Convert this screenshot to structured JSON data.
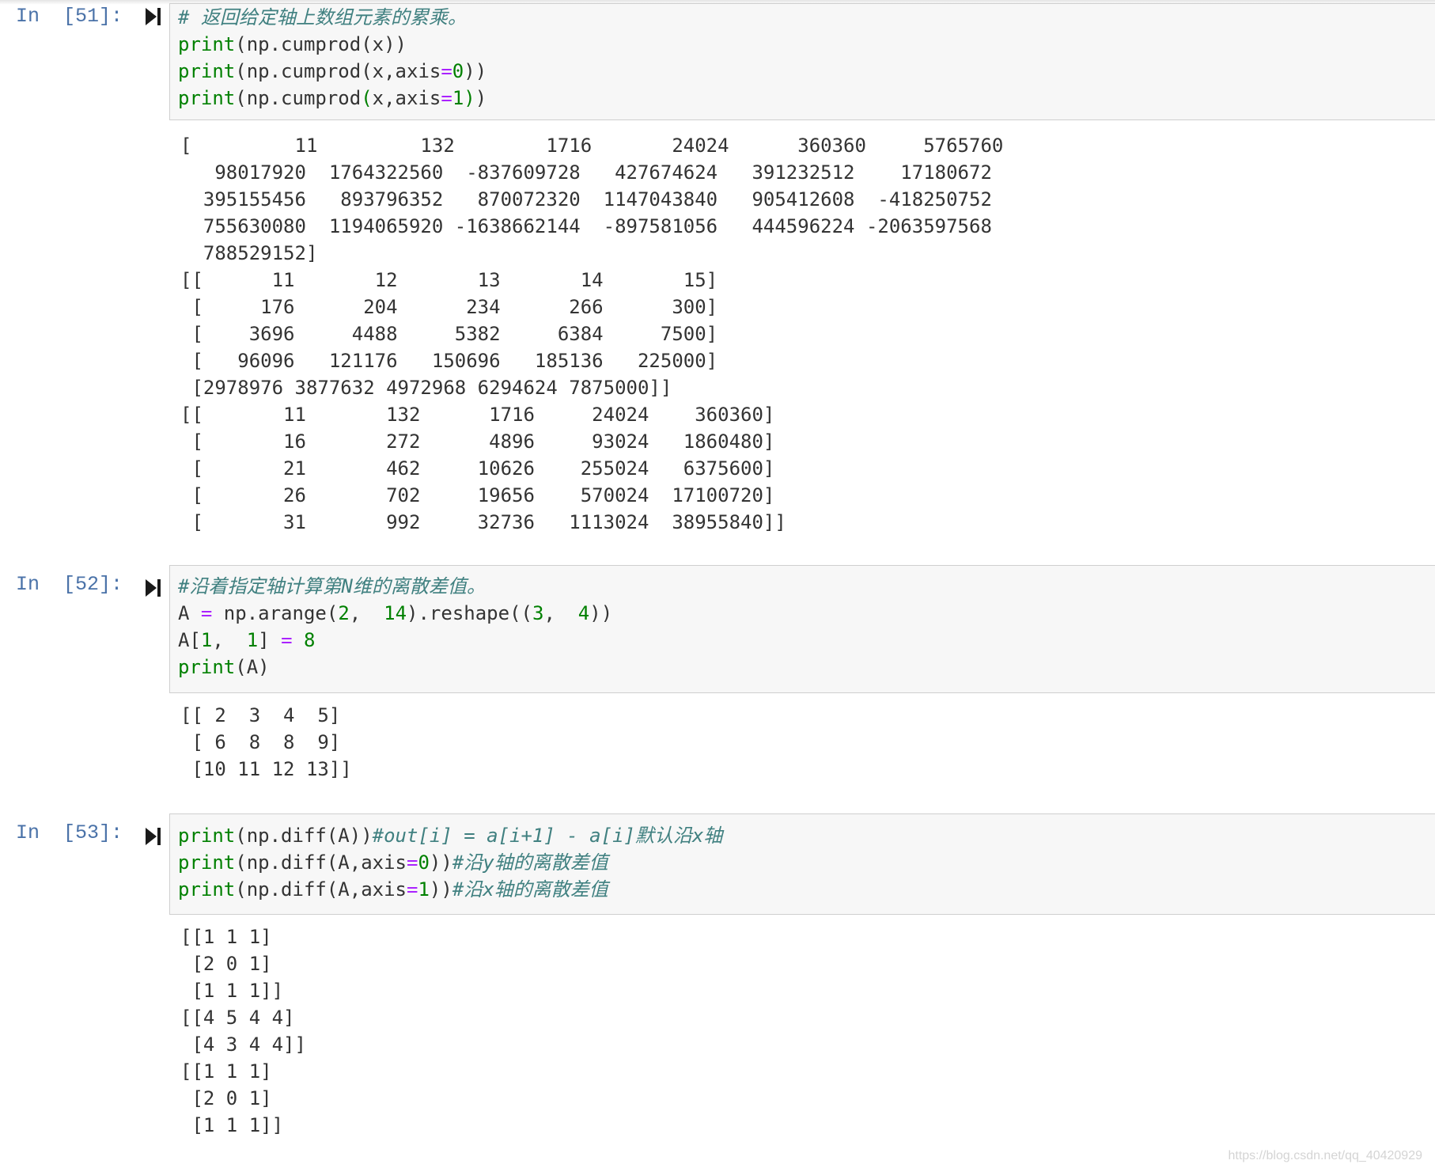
{
  "cells": [
    {
      "prompt": "In  [51]:",
      "code": [
        [
          {
            "t": "cm",
            "v": "# 返回给定轴上数组元素的累乘。"
          }
        ],
        [
          {
            "t": "kw",
            "v": "print"
          },
          {
            "t": "pl",
            "v": "(np.cumprod(x))"
          }
        ],
        [
          {
            "t": "kw",
            "v": "print"
          },
          {
            "t": "pl",
            "v": "(np.cumprod(x,axis"
          },
          {
            "t": "op",
            "v": "="
          },
          {
            "t": "num",
            "v": "0"
          },
          {
            "t": "pl",
            "v": "))"
          }
        ],
        [
          {
            "t": "kw",
            "v": "print"
          },
          {
            "t": "pl",
            "v": "(np.cumprod"
          },
          {
            "t": "kw",
            "v": "("
          },
          {
            "t": "pl",
            "v": "x,axis"
          },
          {
            "t": "op",
            "v": "="
          },
          {
            "t": "num",
            "v": "1"
          },
          {
            "t": "kw",
            "v": ")"
          },
          {
            "t": "pl",
            "v": ")"
          }
        ]
      ],
      "output": [
        "[         11         132        1716       24024      360360     5765760",
        "   98017920  1764322560  -837609728   427674624   391232512    17180672",
        "  395155456   893796352   870072320  1147043840   905412608  -418250752",
        "  755630080  1194065920 -1638662144  -897581056   444596224 -2063597568",
        "  788529152]",
        "[[      11       12       13       14       15]",
        " [     176      204      234      266      300]",
        " [    3696     4488     5382     6384     7500]",
        " [   96096   121176   150696   185136   225000]",
        " [2978976 3877632 4972968 6294624 7875000]]",
        "[[       11       132      1716     24024    360360]",
        " [       16       272      4896     93024   1860480]",
        " [       21       462     10626    255024   6375600]",
        " [       26       702     19656    570024  17100720]",
        " [       31       992     32736   1113024  38955840]]"
      ]
    },
    {
      "prompt": "In  [52]:",
      "code": [
        [
          {
            "t": "cm",
            "v": "#沿着指定轴计算第N维的离散差值。"
          }
        ],
        [
          {
            "t": "pl",
            "v": "A "
          },
          {
            "t": "op",
            "v": "="
          },
          {
            "t": "pl",
            "v": " np.arange("
          },
          {
            "t": "num",
            "v": "2"
          },
          {
            "t": "pl",
            "v": ",  "
          },
          {
            "t": "num",
            "v": "14"
          },
          {
            "t": "pl",
            "v": ").reshape(("
          },
          {
            "t": "num",
            "v": "3"
          },
          {
            "t": "pl",
            "v": ",  "
          },
          {
            "t": "num",
            "v": "4"
          },
          {
            "t": "pl",
            "v": "))"
          }
        ],
        [
          {
            "t": "pl",
            "v": "A["
          },
          {
            "t": "num",
            "v": "1"
          },
          {
            "t": "pl",
            "v": ",  "
          },
          {
            "t": "num",
            "v": "1"
          },
          {
            "t": "pl",
            "v": "] "
          },
          {
            "t": "op",
            "v": "="
          },
          {
            "t": "pl",
            "v": " "
          },
          {
            "t": "num",
            "v": "8"
          }
        ],
        [
          {
            "t": "kw",
            "v": "print"
          },
          {
            "t": "pl",
            "v": "(A)"
          }
        ]
      ],
      "output": [
        "[[ 2  3  4  5]",
        " [ 6  8  8  9]",
        " [10 11 12 13]]"
      ]
    },
    {
      "prompt": "In  [53]:",
      "code": [
        [
          {
            "t": "kw",
            "v": "print"
          },
          {
            "t": "pl",
            "v": "(np.diff(A))"
          },
          {
            "t": "cm",
            "v": "#out[i] = a[i+1] - a[i]默认沿x轴"
          }
        ],
        [
          {
            "t": "kw",
            "v": "print"
          },
          {
            "t": "pl",
            "v": "(np.diff(A,axis"
          },
          {
            "t": "op",
            "v": "="
          },
          {
            "t": "num",
            "v": "0"
          },
          {
            "t": "pl",
            "v": "))"
          },
          {
            "t": "cm",
            "v": "#沿y轴的离散差值"
          }
        ],
        [
          {
            "t": "kw",
            "v": "print"
          },
          {
            "t": "pl",
            "v": "(np.diff(A,axis"
          },
          {
            "t": "op",
            "v": "="
          },
          {
            "t": "num",
            "v": "1"
          },
          {
            "t": "pl",
            "v": "))"
          },
          {
            "t": "cm",
            "v": "#沿x轴的离散差值"
          }
        ]
      ],
      "output": [
        "[[1 1 1]",
        " [2 0 1]",
        " [1 1 1]]",
        "[[4 5 4 4]",
        " [4 3 4 4]]",
        "[[1 1 1]",
        " [2 0 1]",
        " [1 1 1]]"
      ]
    }
  ],
  "watermark": "https://blog.csdn.net/qq_40420929"
}
